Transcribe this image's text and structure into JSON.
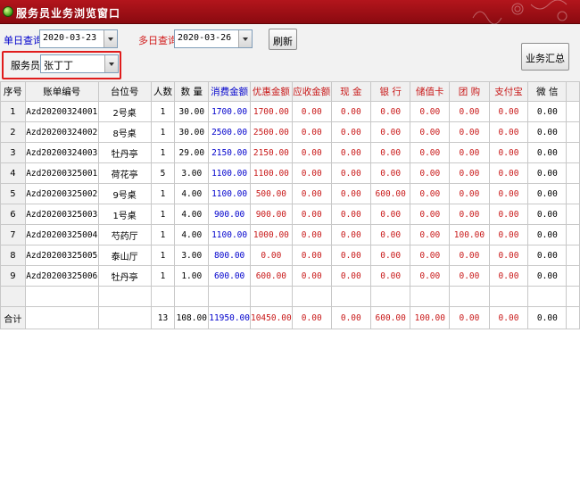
{
  "window": {
    "title": "服务员业务浏览窗口"
  },
  "filters": {
    "single_day_label": "单日查询",
    "single_day_value": "2020-03-23",
    "multi_day_label": "多日查询",
    "multi_day_value": "2020-03-26",
    "refresh_label": "刷新",
    "waiter_label": "服务员",
    "waiter_value": "张丁丁",
    "summary_label": "业务汇总"
  },
  "table": {
    "headers": [
      "序号",
      "账单编号",
      "台位号",
      "人数",
      "数 量",
      "消费金额",
      "优惠金额",
      "应收金额",
      "现 金",
      "银 行",
      "储值卡",
      "团 购",
      "支付宝",
      "微 信"
    ],
    "rows": [
      [
        "1",
        "Azd20200324001",
        "2号桌",
        "1",
        "30.00",
        "1700.00",
        "1700.00",
        "0.00",
        "0.00",
        "0.00",
        "0.00",
        "0.00",
        "0.00",
        "0.00"
      ],
      [
        "2",
        "Azd20200324002",
        "8号桌",
        "1",
        "30.00",
        "2500.00",
        "2500.00",
        "0.00",
        "0.00",
        "0.00",
        "0.00",
        "0.00",
        "0.00",
        "0.00"
      ],
      [
        "3",
        "Azd20200324003",
        "牡丹亭",
        "1",
        "29.00",
        "2150.00",
        "2150.00",
        "0.00",
        "0.00",
        "0.00",
        "0.00",
        "0.00",
        "0.00",
        "0.00"
      ],
      [
        "4",
        "Azd20200325001",
        "荷花亭",
        "5",
        "3.00",
        "1100.00",
        "1100.00",
        "0.00",
        "0.00",
        "0.00",
        "0.00",
        "0.00",
        "0.00",
        "0.00"
      ],
      [
        "5",
        "Azd20200325002",
        "9号桌",
        "1",
        "4.00",
        "1100.00",
        "500.00",
        "0.00",
        "0.00",
        "600.00",
        "0.00",
        "0.00",
        "0.00",
        "0.00"
      ],
      [
        "6",
        "Azd20200325003",
        "1号桌",
        "1",
        "4.00",
        "900.00",
        "900.00",
        "0.00",
        "0.00",
        "0.00",
        "0.00",
        "0.00",
        "0.00",
        "0.00"
      ],
      [
        "7",
        "Azd20200325004",
        "芍药厅",
        "1",
        "4.00",
        "1100.00",
        "1000.00",
        "0.00",
        "0.00",
        "0.00",
        "0.00",
        "100.00",
        "0.00",
        "0.00"
      ],
      [
        "8",
        "Azd20200325005",
        "泰山厅",
        "1",
        "3.00",
        "800.00",
        "0.00",
        "0.00",
        "0.00",
        "0.00",
        "0.00",
        "0.00",
        "0.00",
        "0.00"
      ],
      [
        "9",
        "Azd20200325006",
        "牡丹亭",
        "1",
        "1.00",
        "600.00",
        "600.00",
        "0.00",
        "0.00",
        "0.00",
        "0.00",
        "0.00",
        "0.00",
        "0.00"
      ]
    ],
    "total_row": [
      "合计",
      "",
      "",
      "13",
      "108.00",
      "11950.00",
      "10450.00",
      "0.00",
      "0.00",
      "600.00",
      "100.00",
      "0.00",
      "0.00",
      "0.00"
    ]
  },
  "colors": {
    "title_bar": "#a4111a",
    "highlight_box": "#e01c1c",
    "amount_blue": "#0000cc",
    "amount_red": "#c81818"
  }
}
